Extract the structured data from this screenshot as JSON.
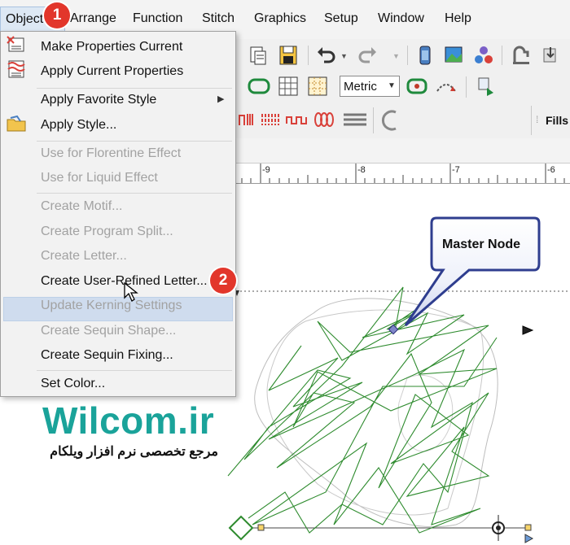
{
  "menubar": {
    "items": [
      "Object",
      "Arrange",
      "Function",
      "Stitch",
      "Graphics",
      "Setup",
      "Window",
      "Help"
    ]
  },
  "toolbar": {
    "units_select": "Metric",
    "fills_label": "Fills"
  },
  "ruler": {
    "labels": [
      "-9",
      "-8",
      "-7",
      "-6"
    ]
  },
  "object_menu": {
    "items": [
      {
        "label": "Make Properties Current",
        "enabled": true
      },
      {
        "label": "Apply Current Properties",
        "enabled": true
      },
      {
        "label": "Apply Favorite Style",
        "enabled": true,
        "submenu": true
      },
      {
        "label": "Apply Style...",
        "enabled": true
      },
      {
        "label": "Use for Florentine Effect",
        "enabled": false
      },
      {
        "label": "Use for Liquid Effect",
        "enabled": false
      },
      {
        "label": "Create Motif...",
        "enabled": false
      },
      {
        "label": "Create Program Split...",
        "enabled": false
      },
      {
        "label": "Create Letter...",
        "enabled": false
      },
      {
        "label": "Create User-Refined Letter...",
        "enabled": true,
        "highlighted": true
      },
      {
        "label": "Update Kerning Settings",
        "enabled": false
      },
      {
        "label": "Create Sequin Shape...",
        "enabled": false
      },
      {
        "label": "Create Sequin Fixing...",
        "enabled": true
      },
      {
        "label": "Set Color...",
        "enabled": true
      }
    ]
  },
  "annotations": {
    "step1": "1",
    "step2": "2",
    "callout": "Master Node"
  },
  "watermark": {
    "brand": "Wilcom.ir",
    "tagline": "مرجع تخصصی نرم افزار ویلکام"
  },
  "colors": {
    "stitch": "#2e8b2e",
    "badge": "#e2362b",
    "brand": "#1aa39a",
    "callout_fill": "#3a4fa8",
    "highlight": "#cfdcee"
  },
  "icons": [
    "undo-icon",
    "redo-icon",
    "save-icon",
    "paste-icon",
    "hoop-icon",
    "grid-icon",
    "pattern-icon",
    "trace-icon"
  ]
}
